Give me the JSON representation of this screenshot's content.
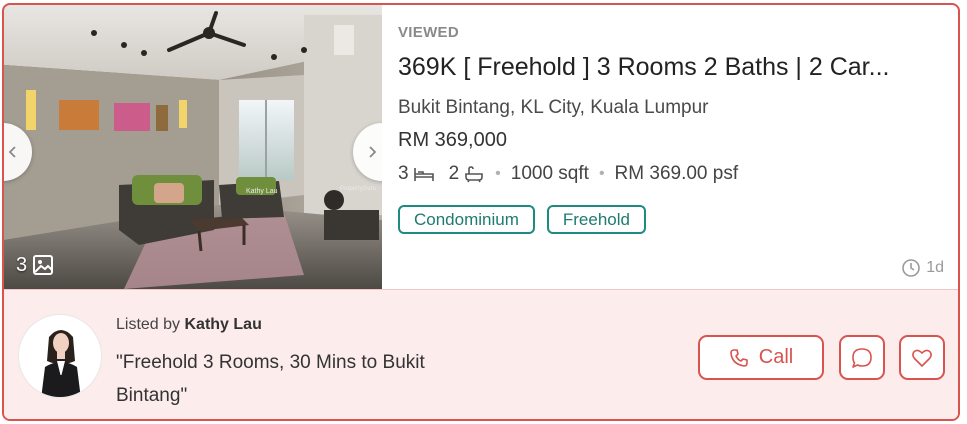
{
  "listing": {
    "status": "VIEWED",
    "title": "369K [ Freehold ] 3 Rooms 2 Baths | 2 Car...",
    "address": "Bukit Bintang, KL City, Kuala Lumpur",
    "price": "RM 369,000",
    "bedrooms": "3",
    "bathrooms": "2",
    "size": "1000 sqft",
    "price_per_sqft": "RM 369.00 psf",
    "separator": "•",
    "tags": [
      "Condominium",
      "Freehold"
    ],
    "age": "1d"
  },
  "gallery": {
    "photo_count": "3",
    "watermark_agent": "Kathy Lau",
    "watermark_brand": "PropertyGuru",
    "icons": {
      "prev": "chevron-left-icon",
      "next": "chevron-right-icon",
      "photos": "image-icon"
    }
  },
  "agent": {
    "listed_by_prefix": "Listed by",
    "name": "Kathy Lau",
    "quote": "\"Freehold 3 Rooms, 30 Mins to Bukit Bintang\""
  },
  "actions": {
    "call_label": "Call",
    "icons": {
      "call": "phone-icon",
      "chat": "chat-icon",
      "favorite": "heart-icon"
    }
  },
  "colors": {
    "accent": "#d9534f",
    "tag": "#1f8a80",
    "footer_bg": "#fdecec",
    "muted": "#8a8a8a"
  }
}
